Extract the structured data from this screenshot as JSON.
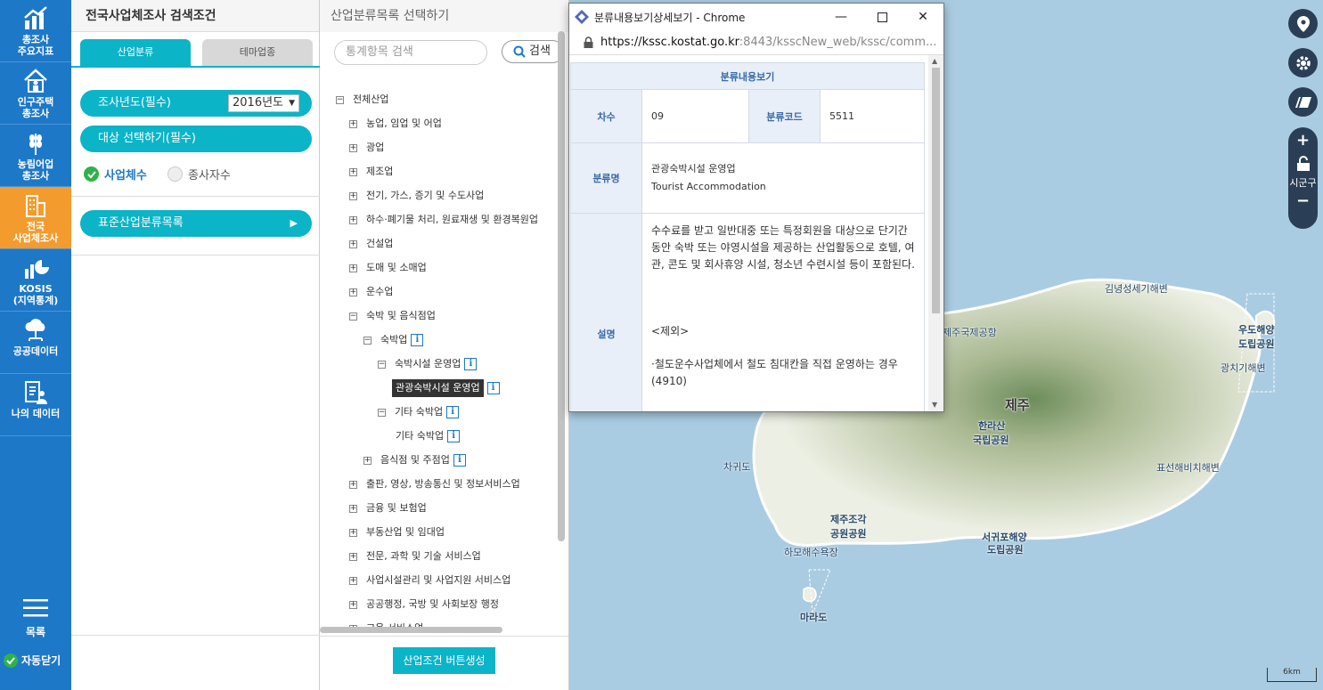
{
  "nav": {
    "items": [
      {
        "label1": "총조사",
        "label2": "주요지표"
      },
      {
        "label1": "인구주택",
        "label2": "총조사"
      },
      {
        "label1": "농림어업",
        "label2": "총조사"
      },
      {
        "label1": "전국",
        "label2": "사업체조사"
      },
      {
        "label1": "KOSIS",
        "label2": "(지역통계)"
      },
      {
        "label1": "공공데이터",
        "label2": ""
      },
      {
        "label1": "나의 데이터",
        "label2": ""
      }
    ],
    "menu_label": "목록",
    "auto_close_label": "자동닫기"
  },
  "search_panel": {
    "title": "전국사업체조사 검색조건",
    "tab_industry": "산업분류",
    "tab_theme": "테마업종",
    "year_label": "조사년도(필수)",
    "year_value": "2016년도",
    "target_label": "대상 선택하기(필수)",
    "radio_business": "사업체수",
    "radio_workers": "종사자수",
    "std_list_label": "표준산업분류목록"
  },
  "tree_panel": {
    "title": "산업분류목록 선택하기",
    "search_placeholder": "통계항목 검색",
    "search_button": "검색",
    "root": "전체산업",
    "items": [
      "농업, 임업 및 어업",
      "광업",
      "제조업",
      "전기, 가스, 증기 및 수도사업",
      "하수·폐기물 처리, 원료재생 및 환경복원업",
      "건설업",
      "도매 및 소매업",
      "운수업",
      "숙박 및 음식점업"
    ],
    "sub1": "숙박업",
    "sub2": "숙박시설 운영업",
    "sub3": "관광숙박시설 운영업",
    "sub4": "기타 숙박업",
    "sub5": "기타 숙박업",
    "sub6": "음식점 및 주점업",
    "items_after": [
      "출판, 영상, 방송통신 및 정보서비스업",
      "금융 및 보험업",
      "부동산업 및 임대업",
      "전문, 과학 및 기술 서비스업",
      "사업시설관리 및 사업지원 서비스업",
      "공공행정, 국방 및 사회보장 행정",
      "교육 서비스업"
    ],
    "generate_button": "산업조건 버튼생성"
  },
  "popup": {
    "window_title": "분류내용보기상세보기 - Chrome",
    "url_host": "https://kssc.kostat.go.kr",
    "url_rest": ":8443/ksscNew_web/kssc/comm...",
    "header": "분류내용보기",
    "label_degree": "차수",
    "value_degree": "09",
    "label_code": "분류코드",
    "value_code": "5511",
    "label_name": "분류명",
    "value_name_ko": "관광숙박시설 운영업",
    "value_name_en": "Tourist Accommodation",
    "label_desc": "설명",
    "desc_text": "수수료를 받고 일반대중 또는 특정회원을 대상으로 단기간동안 숙박 또는 야영시설을 제공하는 산업활동으로 호텔, 여관, 콘도 및 회사휴양 시설, 청소년 수련시설 등이 포함된다.",
    "desc_exclude": "<제외>",
    "desc_exclude_item": "·철도운수사업체에서 철도 침대칸을 직접 운영하는 경우(4910)"
  },
  "map": {
    "labels": [
      "김녕성세기해변",
      "제주국제공항",
      "우도해양",
      "도립공원",
      "광치기해변",
      "제주",
      "한라산",
      "국립공원",
      "차귀도",
      "표선해비치해변",
      "제주조각",
      "공원공원",
      "서귀포해양",
      "도립공원",
      "하모해수욕장",
      "마라도"
    ],
    "side_label": "시군구",
    "scale_label": "6km"
  }
}
